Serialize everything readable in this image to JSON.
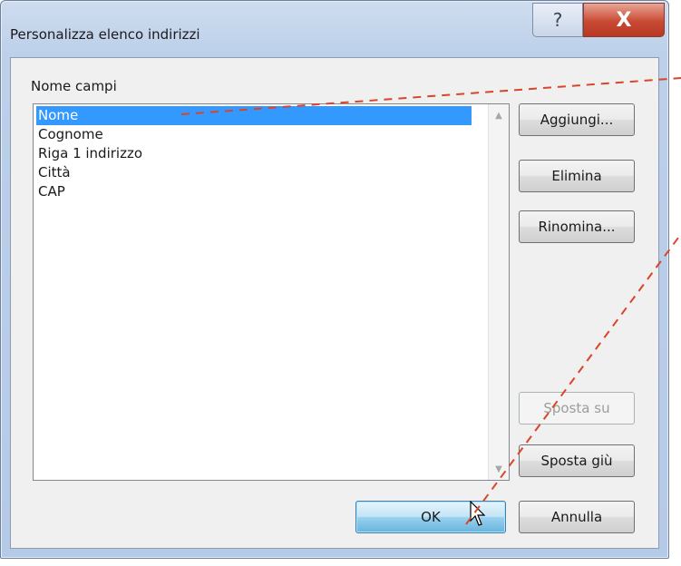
{
  "window": {
    "title": "Personalizza elenco indirizzi",
    "help_glyph": "?",
    "close_glyph": "X"
  },
  "fields": {
    "label": "Nome campi",
    "items": [
      "Nome",
      "Cognome",
      "Riga 1 indirizzo",
      "Città",
      "CAP"
    ],
    "selected": "Nome"
  },
  "buttons": {
    "add": "Aggiungi...",
    "delete": "Elimina",
    "rename": "Rinomina...",
    "move_up": "Sposta su",
    "move_down": "Sposta giù",
    "ok": "OK",
    "cancel": "Annulla"
  },
  "colors": {
    "selection": "#3399ff",
    "close_button": "#c94a33",
    "annotation_line": "#d9442a"
  },
  "icons": [
    "help-icon",
    "close-icon",
    "scroll-up-arrow-icon",
    "scroll-down-arrow-icon",
    "mouse-pointer-icon"
  ]
}
